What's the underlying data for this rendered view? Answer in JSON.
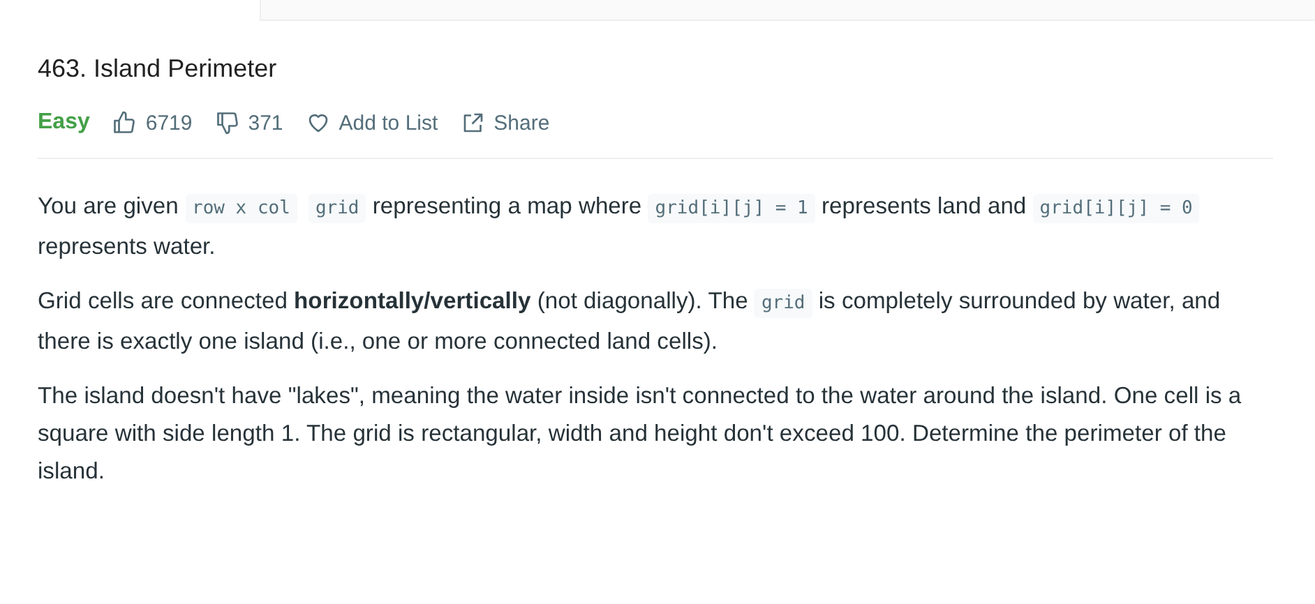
{
  "title": "463. Island Perimeter",
  "difficulty": "Easy",
  "actions": [
    {
      "kind": "like",
      "label": "6719"
    },
    {
      "kind": "dislike",
      "label": "371"
    },
    {
      "kind": "favorite",
      "label": "Add to List"
    },
    {
      "kind": "share",
      "label": "Share"
    }
  ],
  "description": [
    [
      {
        "kind": "text",
        "text": "You are given "
      },
      {
        "kind": "code",
        "text": "row x col"
      },
      {
        "kind": "code",
        "text": "grid"
      },
      {
        "kind": "text",
        "text": " representing a map where "
      },
      {
        "kind": "code",
        "text": "grid[i][j] = 1"
      },
      {
        "kind": "text",
        "text": " represents land and "
      },
      {
        "kind": "code",
        "text": "grid[i][j] = 0"
      },
      {
        "kind": "text",
        "text": " represents water."
      }
    ],
    [
      {
        "kind": "text",
        "text": "Grid cells are connected **horizontally/vertically** (not diagonally). The "
      },
      {
        "kind": "code",
        "text": "grid"
      },
      {
        "kind": "text",
        "text": " is completely surrounded by water, and there is exactly one island (i.e., one or more connected land cells)."
      }
    ],
    [
      {
        "kind": "text",
        "text": "The island doesn't have \"lakes\", meaning the water inside isn't connected to the water around the island. One cell is a square with side length 1. The grid is rectangular, width and height don't exceed 100. Determine the perimeter of the island."
      }
    ]
  ]
}
